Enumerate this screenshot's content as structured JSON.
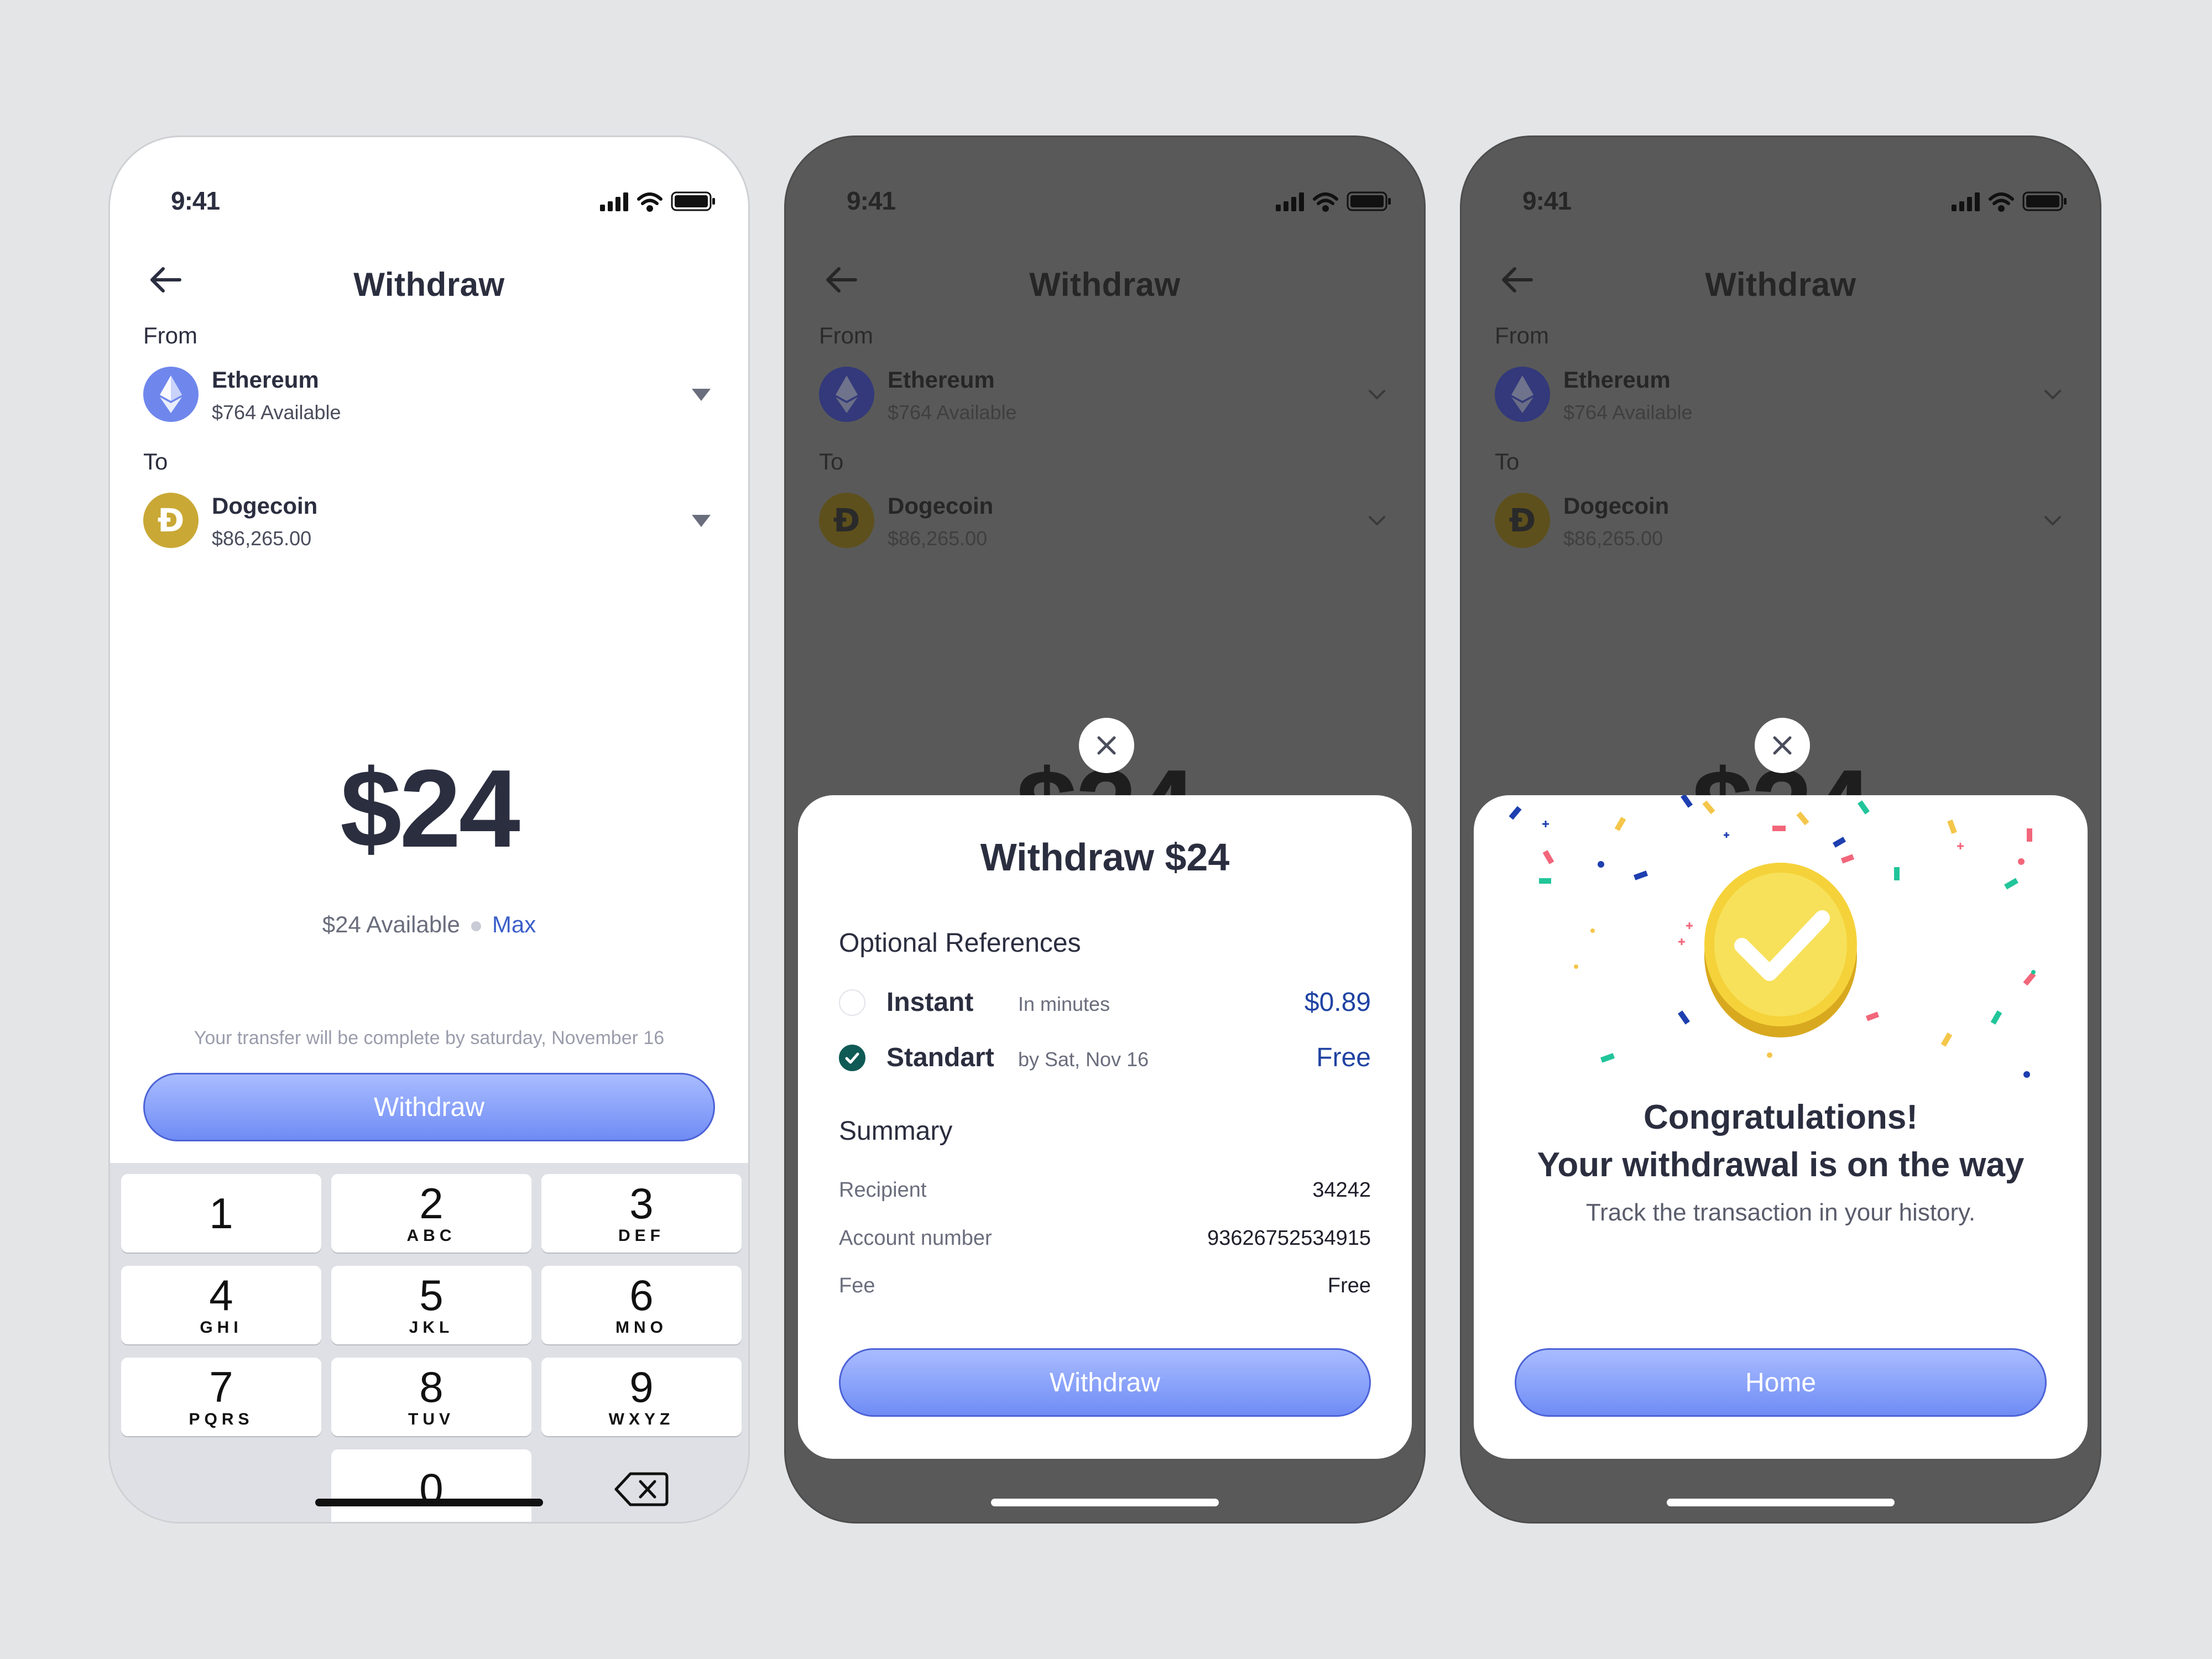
{
  "status": {
    "time": "9:41"
  },
  "screen": {
    "title": "Withdraw",
    "from_label": "From",
    "to_label": "To",
    "from_asset": {
      "name": "Ethereum",
      "sub": "$764 Available"
    },
    "to_asset": {
      "name": "Dogecoin",
      "sub": "$86,265.00"
    },
    "amount": "$24"
  },
  "entry": {
    "available": "$24 Available",
    "max_label": "Max",
    "note": "Your transfer will be complete by saturday, November 16",
    "button": "Withdraw"
  },
  "keypad": {
    "keys": [
      {
        "num": "1",
        "letters": ""
      },
      {
        "num": "2",
        "letters": "ABC"
      },
      {
        "num": "3",
        "letters": "DEF"
      },
      {
        "num": "4",
        "letters": "GHI"
      },
      {
        "num": "5",
        "letters": "JKL"
      },
      {
        "num": "6",
        "letters": "MNO"
      },
      {
        "num": "7",
        "letters": "PQRS"
      },
      {
        "num": "8",
        "letters": "TUV"
      },
      {
        "num": "9",
        "letters": "WXYZ"
      },
      {
        "num": "0",
        "letters": ""
      }
    ]
  },
  "confirm": {
    "title": "Withdraw $24",
    "options_label": "Optional References",
    "options": [
      {
        "name": "Instant",
        "sub": "In minutes",
        "price": "$0.89",
        "selected": false
      },
      {
        "name": "Standart",
        "sub": "by Sat, Nov 16",
        "price": "Free",
        "selected": true
      }
    ],
    "summary_label": "Summary",
    "summary": [
      {
        "key": "Recipient",
        "value": "34242"
      },
      {
        "key": "Account number",
        "value": "93626752534915"
      },
      {
        "key": "Fee",
        "value": "Free"
      }
    ],
    "button": "Withdraw"
  },
  "success": {
    "title_line1": "Congratulations!",
    "title_line2": "Your withdrawal is on the way",
    "subtitle": "Track the transaction in your history.",
    "button": "Home"
  },
  "colors": {
    "accent": "#6f8cf5",
    "ethereum": "#6f87ec",
    "dogecoin": "#c9a835",
    "selected_radio": "#0f5a55",
    "price_blue": "#2043a3"
  },
  "icons": [
    "back-arrow-icon",
    "signal-icon",
    "wifi-icon",
    "battery-icon",
    "ethereum-icon",
    "dogecoin-icon",
    "caret-down-icon",
    "chevron-down-icon",
    "backspace-icon",
    "close-icon",
    "check-icon",
    "success-coin-icon"
  ]
}
